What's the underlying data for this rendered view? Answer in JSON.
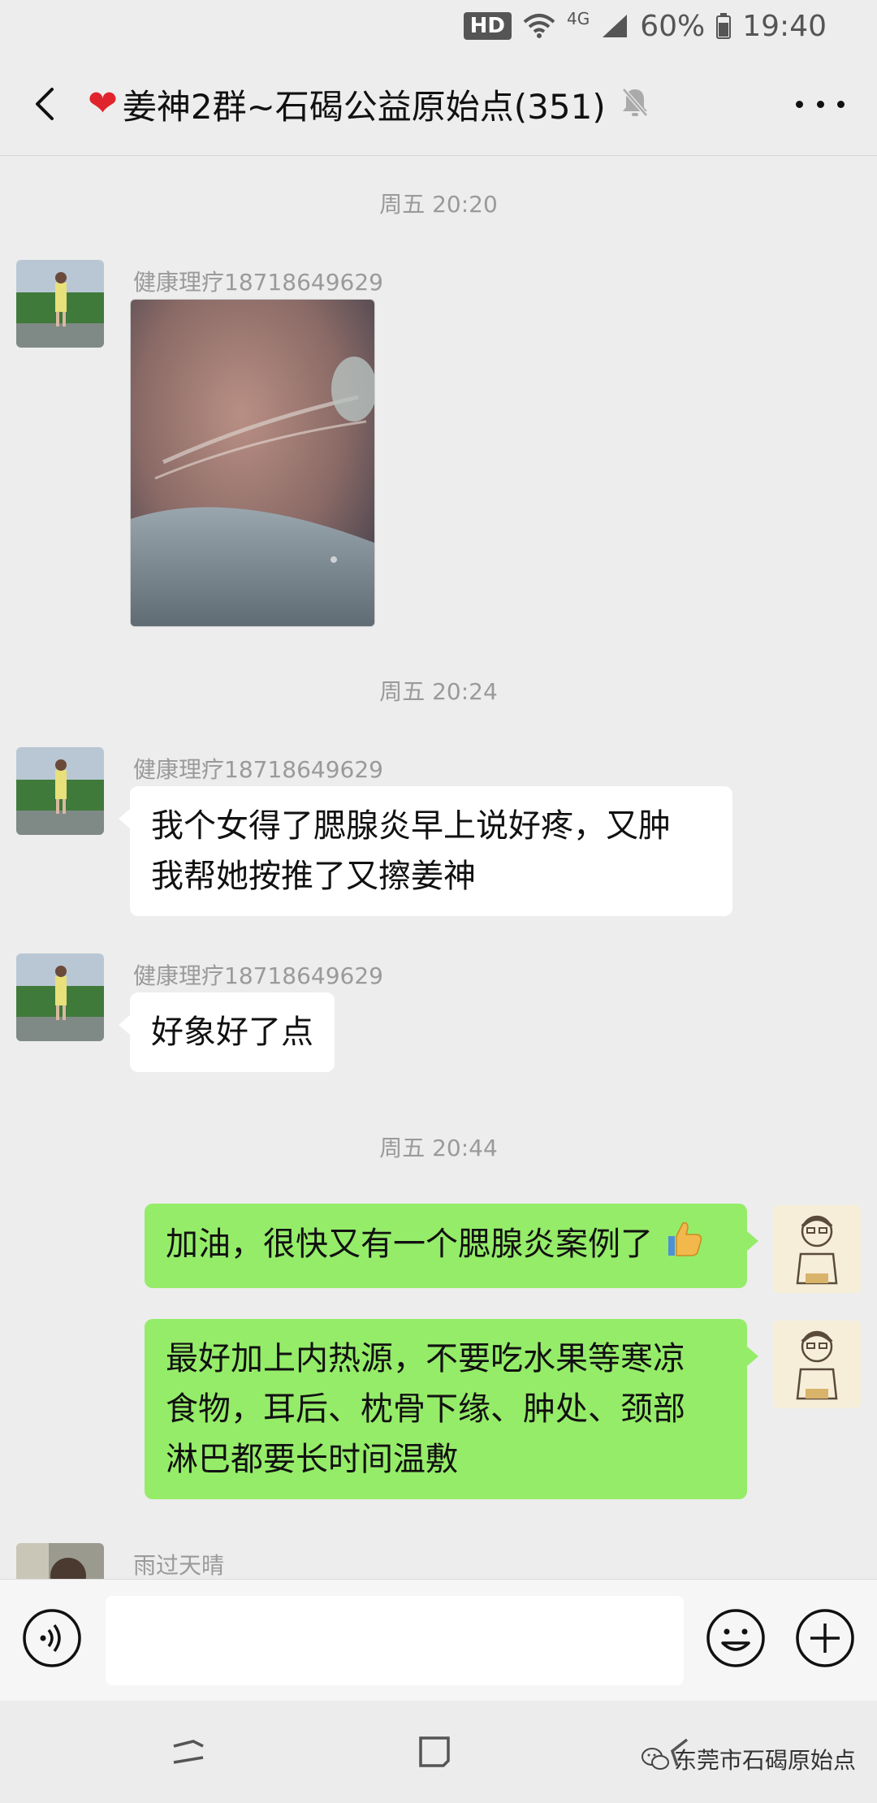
{
  "status_bar": {
    "hd": "HD",
    "network": "4G",
    "battery": "60%",
    "time": "19:40"
  },
  "header": {
    "title": "姜神2群~石碣公益原始点(351)",
    "heart_icon": "heart-icon",
    "muted": true
  },
  "messages": {
    "time1": "周五 20:20",
    "sender1": "健康理疗18718649629",
    "time2": "周五 20:24",
    "sender2": "健康理疗18718649629",
    "text2_line1": "我个女得了腮腺炎早上说好疼，又肿",
    "text2_line2": "我帮她按推了又擦姜神",
    "sender3": "健康理疗18718649629",
    "text3": "好象好了点",
    "time3": "周五 20:44",
    "text4": "加油，很快又有一个腮腺炎案例了",
    "text5_line1": "最好加上内热源，不要吃水果等寒凉",
    "text5_line2": "食物，耳后、枕骨下缘、肿处、颈部",
    "text5_line3": "淋巴都要长时间温敷",
    "sender6": "雨过天晴"
  },
  "input": {
    "placeholder": ""
  },
  "watermark": {
    "text": "东莞市石碣原始点"
  },
  "colors": {
    "background": "#ededed",
    "bubble_green": "#95ec69",
    "bubble_white": "#ffffff"
  }
}
